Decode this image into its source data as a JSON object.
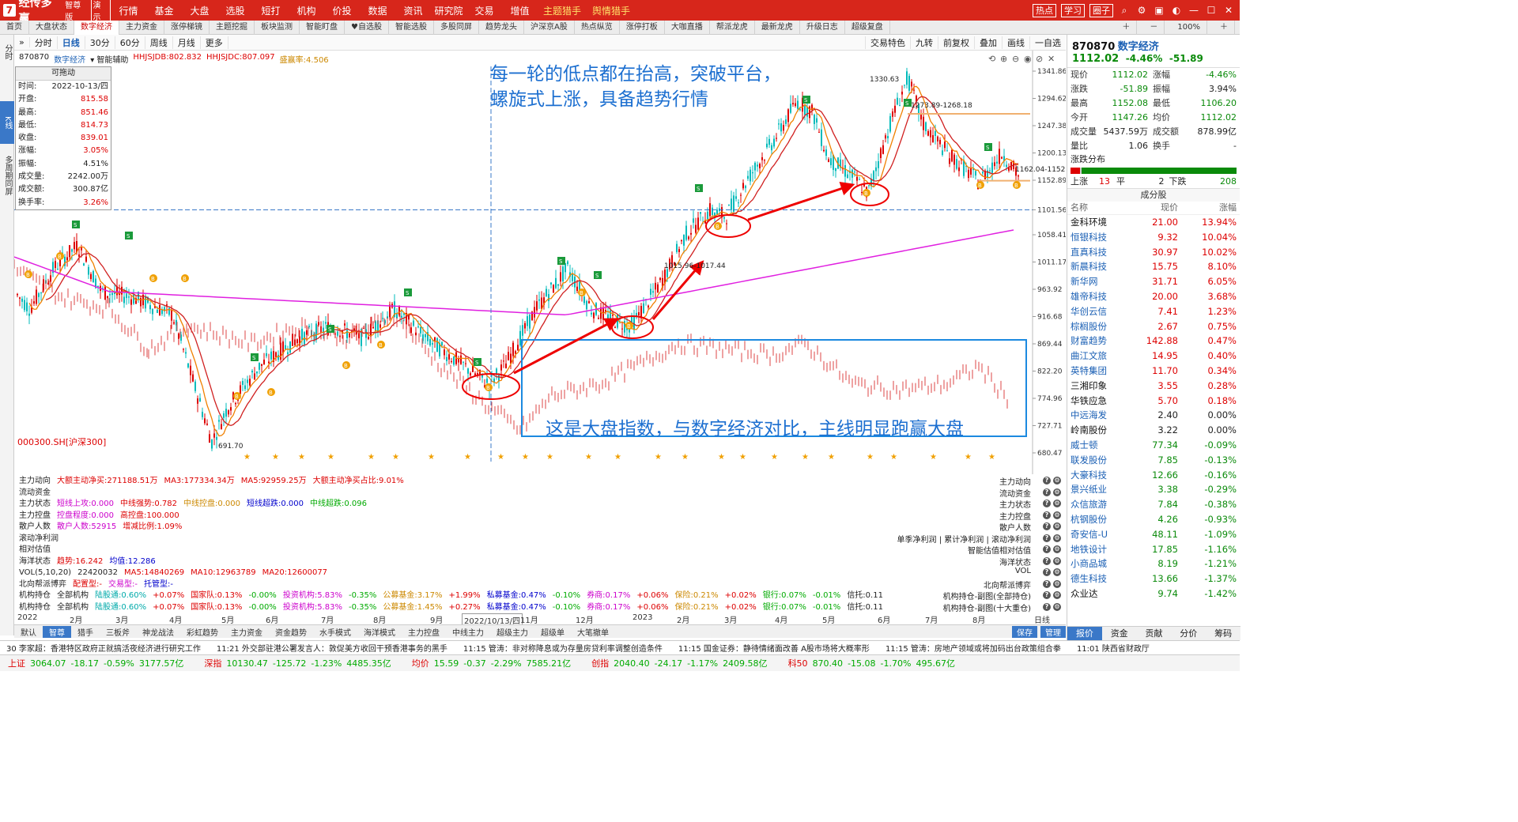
{
  "app": {
    "name": "经传多赢",
    "edition": "智尊版",
    "demo": "演示",
    "nav": [
      "行情",
      "基金",
      "大盘",
      "选股",
      "短打",
      "机构",
      "价投",
      "数据",
      "资讯",
      "研究院",
      "交易",
      "增值"
    ],
    "nav_highlight": [
      "主题猎手",
      "舆情猎手"
    ],
    "top_buttons": [
      "热点",
      "学习",
      "圈子"
    ]
  },
  "tabs": [
    "首页",
    "大盘状态",
    "数字经济",
    "主力资金",
    "涨停梯镜",
    "主题挖掘",
    "板块监测",
    "智能盯盘",
    "♥自选股",
    "智能选股",
    "多股同屏",
    "趋势龙头",
    "沪深京A股",
    "热点纵览",
    "涨停打板",
    "大咖直播",
    "帮派龙虎",
    "最新龙虎",
    "升级日志",
    "超级复盘"
  ],
  "tabs_active": 2,
  "tab_right": {
    "zoom": "100%"
  },
  "left_rail": [
    "分时",
    "K线",
    "多周期同屏"
  ],
  "toolbar": {
    "items": [
      "分时",
      "日线",
      "30分",
      "60分",
      "周线",
      "月线",
      "更多"
    ],
    "active": 1,
    "right": [
      "交易特色",
      "九转",
      "前复权",
      "叠加",
      "画线",
      "一自选"
    ]
  },
  "chart_header": {
    "code": "870870",
    "name": "数字经济",
    "assist": "智能辅助",
    "hhjsjdb": "HHJSJDB:802.832",
    "hhjsjdc": "HHJSJDC:807.097",
    "sheng": "盛赢率:4.506"
  },
  "cursor": {
    "title": "可拖动",
    "rows": [
      {
        "k": "时间:",
        "v": "2022-10-13/四",
        "c": "bk"
      },
      {
        "k": "开盘:",
        "v": "815.58",
        "c": "rd"
      },
      {
        "k": "最高:",
        "v": "851.46",
        "c": "rd"
      },
      {
        "k": "最低:",
        "v": "814.73",
        "c": "rd"
      },
      {
        "k": "收盘:",
        "v": "839.01",
        "c": "rd"
      },
      {
        "k": "涨幅:",
        "v": "3.05%",
        "c": "rd"
      },
      {
        "k": "振幅:",
        "v": "4.51%",
        "c": "bk"
      },
      {
        "k": "成交量:",
        "v": "2242.00万",
        "c": "bk"
      },
      {
        "k": "成交额:",
        "v": "300.87亿",
        "c": "bk"
      },
      {
        "k": "换手率:",
        "v": "3.26%",
        "c": "rd"
      }
    ]
  },
  "annotation_top": "每一轮的低点都在抬高，突破平台，螺旋式上涨，具备趋势行情",
  "annotation_bottom": "这是大盘指数，与数字经济对比，主线明显跑赢大盘",
  "overlay_index_label": "000300.SH[沪深300]",
  "price_labels": {
    "high": "1330.63",
    "low": "691.70",
    "mid1": "1015.96-1017.44",
    "mid2": "1273.89-1268.18",
    "cur": "1162.04-1152.0"
  },
  "y_axis": [
    "1341.86",
    "1294.62",
    "1247.38",
    "1200.13",
    "1152.89",
    "1101.56",
    "1058.41",
    "1011.17",
    "963.92",
    "916.68",
    "869.44",
    "822.20",
    "774.96",
    "727.71",
    "680.47"
  ],
  "x_axis": [
    "2022",
    "2月",
    "3月",
    "4月",
    "5月",
    "6月",
    "7月",
    "8月",
    "9月",
    "2022/10/13/四",
    "11月",
    "12月",
    "2023",
    "2月",
    "3月",
    "4月",
    "5月",
    "6月",
    "7月",
    "8月",
    "日线"
  ],
  "indicators": [
    {
      "name": "主力动向",
      "parts": [
        {
          "t": "大额主动净买:271188.51万",
          "c": "#d00"
        },
        {
          "t": "MA3:177334.34万",
          "c": "#d00"
        },
        {
          "t": "MA5:92959.25万",
          "c": "#d00"
        },
        {
          "t": "大额主动净买占比:9.01%",
          "c": "#d00"
        }
      ],
      "right": "主力动向"
    },
    {
      "name": "流动资金",
      "parts": [],
      "right": "流动资金"
    },
    {
      "name": "主力状态",
      "parts": [
        {
          "t": "短线上攻:0.000",
          "c": "#c0c"
        },
        {
          "t": "中线强势:0.782",
          "c": "#d00"
        },
        {
          "t": "中线控盘:0.000",
          "c": "#c80"
        },
        {
          "t": "短线超跌:0.000",
          "c": "#00c"
        },
        {
          "t": "中线超跌:0.096",
          "c": "#0a0"
        }
      ],
      "right": "主力状态"
    },
    {
      "name": "主力控盘",
      "parts": [
        {
          "t": "控盘程度:0.000",
          "c": "#c0c"
        },
        {
          "t": "高控盘:100.000",
          "c": "#d00"
        }
      ],
      "right": "主力控盘"
    },
    {
      "name": "散户人数",
      "parts": [
        {
          "t": "散户人数:52915",
          "c": "#c0c"
        },
        {
          "t": "增减比例:1.09%",
          "c": "#d00"
        }
      ],
      "right": "散户人数"
    },
    {
      "name": "滚动净利润",
      "parts": [],
      "right": "单季净利润 | 累计净利润 | 滚动净利润"
    },
    {
      "name": "相对估值",
      "parts": [],
      "right": "智能估值相对估值"
    },
    {
      "name": "海洋状态",
      "parts": [
        {
          "t": "趋势:16.242",
          "c": "#d00"
        },
        {
          "t": "均值:12.286",
          "c": "#00c"
        }
      ],
      "right": "海洋状态"
    },
    {
      "name": "VOL(5,10,20)",
      "parts": [
        {
          "t": "22420032",
          "c": "#222"
        },
        {
          "t": "MA5:14840269",
          "c": "#d00"
        },
        {
          "t": "MA10:12963789",
          "c": "#d00"
        },
        {
          "t": "MA20:12600077",
          "c": "#d00"
        }
      ],
      "right": "VOL"
    },
    {
      "name": "北向帮派博弈",
      "parts": [
        {
          "t": "配置型:-",
          "c": "#d00"
        },
        {
          "t": "交易型:-",
          "c": "#c0c"
        },
        {
          "t": "托管型:-",
          "c": "#00c"
        }
      ],
      "right": "北向帮派博弈"
    },
    {
      "name": "机构持仓",
      "parts": [
        {
          "t": "全部机构",
          "c": "#222"
        },
        {
          "t": "陆股通:0.60%",
          "c": "#0aa"
        },
        {
          "t": "+0.07%",
          "c": "#d00"
        },
        {
          "t": "国家队:0.13%",
          "c": "#d00"
        },
        {
          "t": "-0.00%",
          "c": "#0a0"
        },
        {
          "t": "投资机构:5.83%",
          "c": "#c0c"
        },
        {
          "t": "-0.35%",
          "c": "#0a0"
        },
        {
          "t": "公募基金:3.17%",
          "c": "#c80"
        },
        {
          "t": "+1.99%",
          "c": "#d00"
        },
        {
          "t": "私募基金:0.47%",
          "c": "#00c"
        },
        {
          "t": "-0.10%",
          "c": "#0a0"
        },
        {
          "t": "券商:0.17%",
          "c": "#c0c"
        },
        {
          "t": "+0.06%",
          "c": "#d00"
        },
        {
          "t": "保险:0.21%",
          "c": "#c80"
        },
        {
          "t": "+0.02%",
          "c": "#d00"
        },
        {
          "t": "银行:0.07%",
          "c": "#0a0"
        },
        {
          "t": "-0.01%",
          "c": "#0a0"
        },
        {
          "t": "信托:0.11",
          "c": "#222"
        }
      ],
      "right": "机构持仓-副图(全部持仓)"
    },
    {
      "name": "机构持仓",
      "parts": [
        {
          "t": "全部机构",
          "c": "#222"
        },
        {
          "t": "陆股通:0.60%",
          "c": "#0aa"
        },
        {
          "t": "+0.07%",
          "c": "#d00"
        },
        {
          "t": "国家队:0.13%",
          "c": "#d00"
        },
        {
          "t": "-0.00%",
          "c": "#0a0"
        },
        {
          "t": "投资机构:5.83%",
          "c": "#c0c"
        },
        {
          "t": "-0.35%",
          "c": "#0a0"
        },
        {
          "t": "公募基金:1.45%",
          "c": "#c80"
        },
        {
          "t": "+0.27%",
          "c": "#d00"
        },
        {
          "t": "私募基金:0.47%",
          "c": "#00c"
        },
        {
          "t": "-0.10%",
          "c": "#0a0"
        },
        {
          "t": "券商:0.17%",
          "c": "#c0c"
        },
        {
          "t": "+0.06%",
          "c": "#d00"
        },
        {
          "t": "保险:0.21%",
          "c": "#c80"
        },
        {
          "t": "+0.02%",
          "c": "#d00"
        },
        {
          "t": "银行:0.07%",
          "c": "#0a0"
        },
        {
          "t": "-0.01%",
          "c": "#0a0"
        },
        {
          "t": "信托:0.11",
          "c": "#222"
        }
      ],
      "right": "机构持仓-副图(十大重仓)"
    }
  ],
  "bottom_tabs": [
    "默认",
    "智尊",
    "猎手",
    "三板斧",
    "神龙战法",
    "彩虹趋势",
    "主力资金",
    "资金趋势",
    "水手模式",
    "海洋模式",
    "主力控盘",
    "中线主力",
    "超级主力",
    "超级单",
    "大笔撤单"
  ],
  "bottom_tabs_active": 1,
  "bottom_right": [
    "保存",
    "管理"
  ],
  "news": [
    "30 李家超：香港特区政府正就搞活夜经济进行研究工作",
    "11:21 外交部驻港公署发言人：敦促美方收回干预香港事务的黑手",
    "11:15 管涛：非对称降息或为存量房贷利率调整创造条件",
    "11:15 国金证券：静待情绪面改善 A股市场将大概率形",
    "11:15 管涛：房地产领域或将加码出台政策组合拳",
    "11:01 陕西省财政厅"
  ],
  "ticker": [
    {
      "name": "上证",
      "val": "3064.07",
      "chg": "-18.17",
      "pct": "-0.59%",
      "amt": "3177.57亿"
    },
    {
      "name": "深指",
      "val": "10130.47",
      "chg": "-125.72",
      "pct": "-1.23%",
      "amt": "4485.35亿"
    },
    {
      "name": "均价",
      "val": "15.59",
      "chg": "-0.37",
      "pct": "-2.29%",
      "amt": "7585.21亿"
    },
    {
      "name": "创指",
      "val": "2040.40",
      "chg": "-24.17",
      "pct": "-1.17%",
      "amt": "2409.58亿"
    },
    {
      "name": "科50",
      "val": "870.40",
      "chg": "-15.08",
      "pct": "-1.70%",
      "amt": "495.67亿"
    }
  ],
  "quote": {
    "code": "870870",
    "name": "数字经济",
    "price": "1112.02",
    "pct": "-4.46%",
    "chg": "-51.89",
    "rows": [
      {
        "k": "现价",
        "v": "1112.02",
        "vc": "gr",
        "k2": "涨幅",
        "v2": "-4.46%",
        "v2c": "gr"
      },
      {
        "k": "涨跌",
        "v": "-51.89",
        "vc": "gr",
        "k2": "振幅",
        "v2": "3.94%",
        "v2c": ""
      },
      {
        "k": "最高",
        "v": "1152.08",
        "vc": "gr",
        "k2": "最低",
        "v2": "1106.20",
        "v2c": "gr"
      },
      {
        "k": "今开",
        "v": "1147.26",
        "vc": "gr",
        "k2": "均价",
        "v2": "1112.02",
        "v2c": "gr"
      },
      {
        "k": "成交量",
        "v": "5437.59万",
        "vc": "",
        "k2": "成交额",
        "v2": "878.99亿",
        "v2c": ""
      },
      {
        "k": "量比",
        "v": "1.06",
        "vc": "",
        "k2": "换手",
        "v2": "-",
        "v2c": ""
      }
    ],
    "dist_label": "涨跌分布",
    "up_label": "上涨",
    "up": "13",
    "flat_label": "平",
    "flat": "2",
    "down_label": "下跌",
    "down": "208"
  },
  "constituents": {
    "title": "成分股",
    "cols": [
      "名称",
      "现价",
      "涨幅"
    ],
    "rows": [
      {
        "n": "金科环境",
        "p": "21.00",
        "c": "13.94%",
        "u": 1,
        "nb": 1
      },
      {
        "n": "恒银科技",
        "p": "9.32",
        "c": "10.04%",
        "u": 1
      },
      {
        "n": "直真科技",
        "p": "30.97",
        "c": "10.02%",
        "u": 1
      },
      {
        "n": "新晨科技",
        "p": "15.75",
        "c": "8.10%",
        "u": 1
      },
      {
        "n": "新华网",
        "p": "31.71",
        "c": "6.05%",
        "u": 1
      },
      {
        "n": "雄帝科技",
        "p": "20.00",
        "c": "3.68%",
        "u": 1
      },
      {
        "n": "华创云信",
        "p": "7.41",
        "c": "1.23%",
        "u": 1
      },
      {
        "n": "棕榈股份",
        "p": "2.67",
        "c": "0.75%",
        "u": 1
      },
      {
        "n": "财富趋势",
        "p": "142.88",
        "c": "0.47%",
        "u": 1
      },
      {
        "n": "曲江文旅",
        "p": "14.95",
        "c": "0.40%",
        "u": 1
      },
      {
        "n": "英特集团",
        "p": "11.70",
        "c": "0.34%",
        "u": 1
      },
      {
        "n": "三湘印象",
        "p": "3.55",
        "c": "0.28%",
        "u": 1,
        "nb": 1
      },
      {
        "n": "华铁应急",
        "p": "5.70",
        "c": "0.18%",
        "u": 1,
        "nb": 1
      },
      {
        "n": "中远海发",
        "p": "2.40",
        "c": "0.00%",
        "u": 0
      },
      {
        "n": "岭南股份",
        "p": "3.22",
        "c": "0.00%",
        "u": 0,
        "nb": 1
      },
      {
        "n": "威士顿",
        "p": "77.34",
        "c": "-0.09%",
        "u": -1
      },
      {
        "n": "联发股份",
        "p": "7.85",
        "c": "-0.13%",
        "u": -1
      },
      {
        "n": "大豪科技",
        "p": "12.66",
        "c": "-0.16%",
        "u": -1
      },
      {
        "n": "景兴纸业",
        "p": "3.38",
        "c": "-0.29%",
        "u": -1
      },
      {
        "n": "众信旅游",
        "p": "7.84",
        "c": "-0.38%",
        "u": -1
      },
      {
        "n": "杭钢股份",
        "p": "4.26",
        "c": "-0.93%",
        "u": -1
      },
      {
        "n": "奇安信-U",
        "p": "48.11",
        "c": "-1.09%",
        "u": -1
      },
      {
        "n": "地铁设计",
        "p": "17.85",
        "c": "-1.16%",
        "u": -1
      },
      {
        "n": "小商品城",
        "p": "8.19",
        "c": "-1.21%",
        "u": -1
      },
      {
        "n": "德生科技",
        "p": "13.66",
        "c": "-1.37%",
        "u": -1
      },
      {
        "n": "众业达",
        "p": "9.74",
        "c": "-1.42%",
        "u": -1,
        "nb": 1
      }
    ]
  },
  "right_bottom_tabs": [
    "报价",
    "资金",
    "贡献",
    "分价",
    "筹码"
  ],
  "chart_data": {
    "type": "line",
    "title": "",
    "series": [
      {
        "name": "",
        "x": [
          "2022",
          "4月",
          "5月",
          "8月",
          "9月",
          "2022/10/13/四",
          "12月",
          "2023",
          "4月",
          "6月",
          "8月"
        ],
        "values": [
          960,
          930,
          692,
          930,
          800,
          839,
          905,
          1050,
          1290,
          1080,
          1112
        ]
      },
      {
        "name": "000300.SH[沪深300]",
        "values": [
          990,
          900,
          780,
          880,
          760,
          740,
          800,
          860,
          830,
          790,
          770
        ]
      }
    ],
    "ylim": [
      680.47,
      1341.86
    ]
  }
}
